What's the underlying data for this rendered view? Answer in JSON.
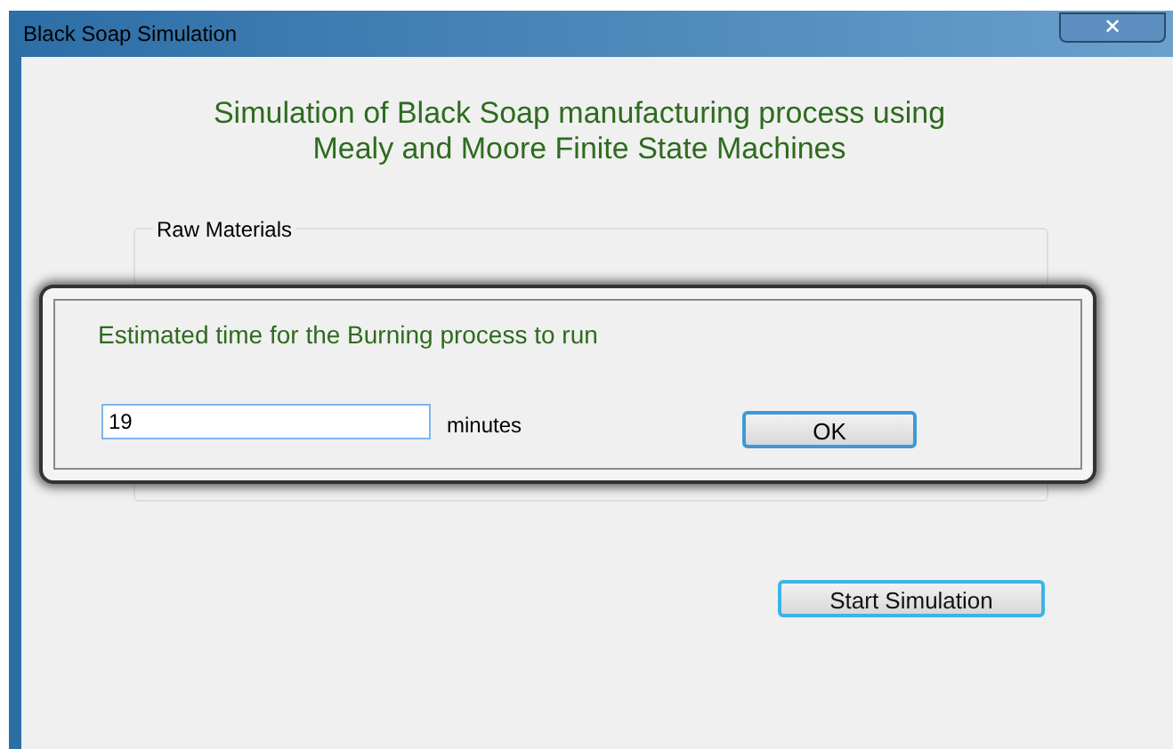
{
  "window": {
    "title": "Black Soap Simulation",
    "close": "✕"
  },
  "heading": [
    "Simulation of Black Soap manufacturing process using",
    "Mealy and Moore Finite State Machines"
  ],
  "group": {
    "title": "Raw Materials"
  },
  "dialog": {
    "prompt": "Estimated time for the Burning process to run",
    "value": "19",
    "unit": "minutes",
    "ok": "OK"
  },
  "buttons": [
    {
      "label": "Start Simulation",
      "focused": true
    }
  ]
}
